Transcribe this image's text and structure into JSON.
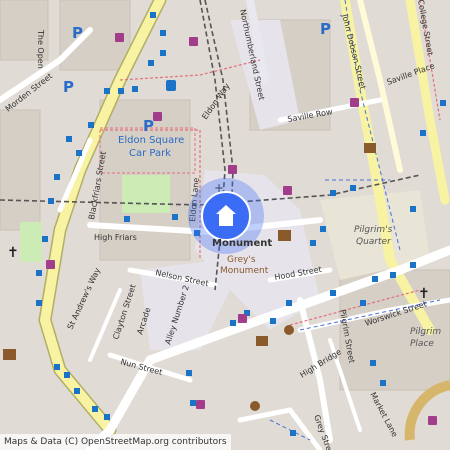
{
  "map": {
    "streets": {
      "the_open": "The Open",
      "morden": "Morden Street",
      "blackfriars_st": "Blackfriars Street",
      "high_friars": "High Friars",
      "st_andrews_way": "St Andrew's Way",
      "clayton": "Clayton Street",
      "arcade": "Arcade",
      "alley_number_2": "Alley Number 2",
      "nelson": "Nelson Street",
      "nun": "Nun Street",
      "eldon_lane": "Eldon Lane",
      "eldon_way": "Eldon Way",
      "northumberland": "Northumberland Street",
      "saville_row": "Saville Row",
      "saville_place": "Saville Place",
      "john_dobson": "John Dobson Street",
      "college": "College Street",
      "hood": "Hood Street",
      "pilgrim_st": "Pilgrim Street",
      "worswick": "Worswick Street",
      "high_bridge": "High Bridge",
      "market_lane": "Market Lane",
      "grey": "Grey Street"
    },
    "places": {
      "eldon_line1": "Eldon Square",
      "eldon_line2": "Car Park",
      "monument": "Monument",
      "greys_line1": "Grey's",
      "greys_line2": "Monument",
      "pilgrims_line1": "Pilgrim's",
      "pilgrims_line2": "Quarter",
      "pilgrim_place_line1": "Pilgrim",
      "pilgrim_place_line2": "Place"
    },
    "icons": [
      "parking-icon",
      "shopping-bag-icon",
      "bus-icon",
      "cinema-icon",
      "theatre-icon",
      "church-icon",
      "library-icon",
      "location-marker-icon"
    ],
    "colors": {
      "marker": "#3b6cf5",
      "bus_stop": "#1a73c6",
      "primary_road": "#f7f3a3",
      "pedestrian": "#e4e2ea",
      "park": "#c8e8b0",
      "parking": "#2a6cc7",
      "shop": "#a13d8a"
    }
  },
  "attribution": "Maps & Data (C) OpenStreetMap.org contributors"
}
